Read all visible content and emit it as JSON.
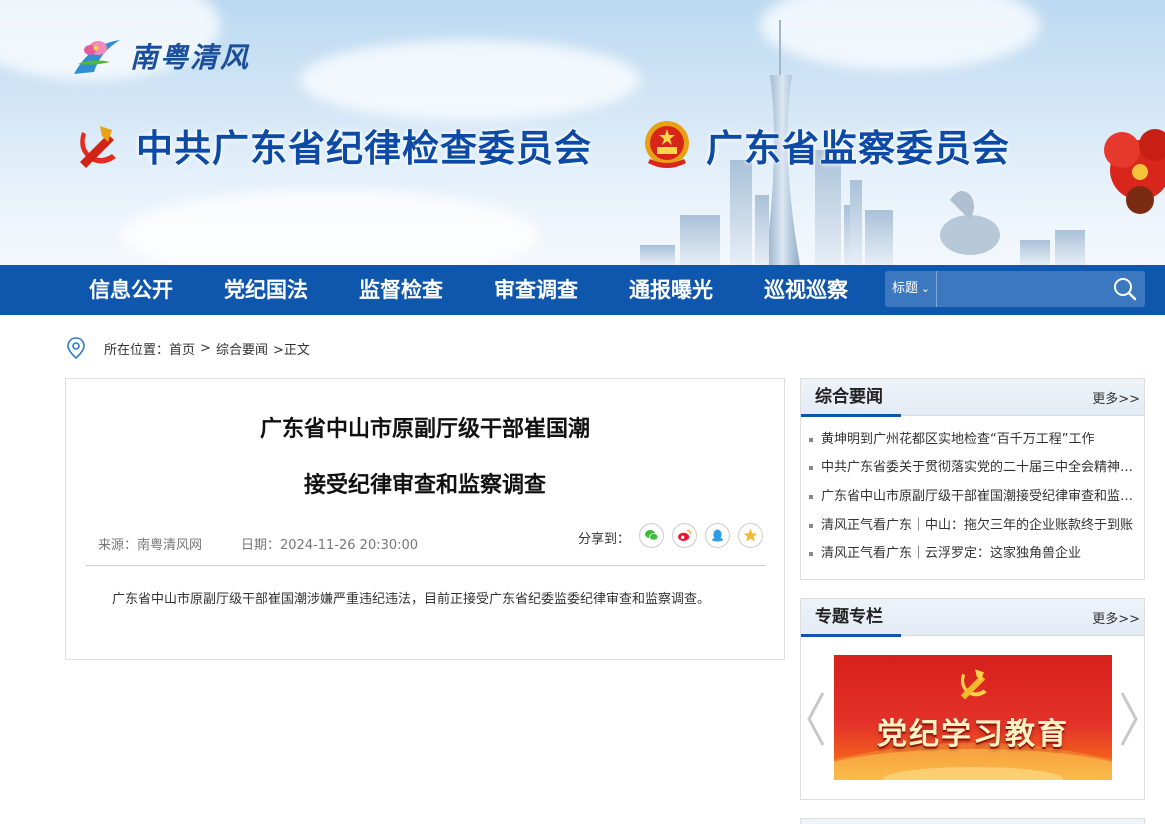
{
  "header": {
    "logo_text": "南粤清风",
    "org_party": "中共广东省纪律检查委员会",
    "org_state": "广东省监察委员会"
  },
  "nav": {
    "items": [
      "信息公开",
      "党纪国法",
      "监督检查",
      "审查调查",
      "通报曝光",
      "巡视巡察"
    ],
    "search_type": "标题",
    "search_placeholder": ""
  },
  "breadcrumb": {
    "label": "所在位置：",
    "home": "首页",
    "section": "综合要闻",
    "current": ">正文",
    "separator": ">"
  },
  "article": {
    "title_line1": "广东省中山市原副厅级干部崔国潮",
    "title_line2": "接受纪律审查和监察调查",
    "source": "来源：南粤清风网",
    "date": "日期：2024-11-26 20:30:00",
    "share_label": "分享到：",
    "body": "广东省中山市原副厅级干部崔国潮涉嫌严重违纪违法，目前正接受广东省纪委监委纪律审查和监察调查。"
  },
  "sidebar": {
    "news_panel": {
      "title": "综合要闻",
      "more": "更多>>",
      "items": [
        "黄坤明到广州花都区实地检查“百千万工程”工作",
        "中共广东省委关于贯彻落实党的二十届三中全会精神的意见",
        "广东省中山市原副厅级干部崔国潮接受纪律审查和监察调查",
        "清风正气看广东｜中山：拖欠三年的企业账款终于到账",
        "清风正气看广东｜云浮罗定：这家独角兽企业"
      ]
    },
    "topic_panel": {
      "title": "专题专栏",
      "more": "更多>>",
      "banner_text": "党纪学习教育"
    }
  },
  "colors": {
    "nav_blue": "#0f56ad",
    "title_blue": "#0c4aa6",
    "promo_red": "#d6201b"
  }
}
